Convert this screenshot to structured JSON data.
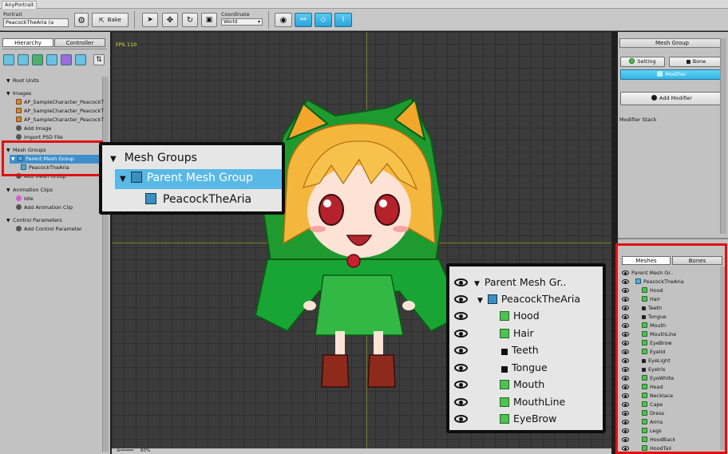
{
  "app": {
    "title": "AnyPortrait"
  },
  "toolbar": {
    "portrait_label": "Portrait",
    "portrait_value": "PeacockTheAria (a",
    "bake_label": "Bake",
    "coordinate_label": "Coordinate",
    "coordinate_value": "World"
  },
  "left_panel": {
    "tabs": [
      "Hierarchy",
      "Controller"
    ],
    "root_units": "Root Units",
    "images_header": "Images",
    "images": [
      "AP_SampleCharacter_PeacockT",
      "AP_SampleCharacter_PeacockT",
      "AP_SampleCharacter_PeacockT"
    ],
    "add_image": "Add Image",
    "import_psd": "Import PSD File",
    "mesh_groups_header": "Mesh Groups",
    "parent_mesh_group": "Parent Mesh Group",
    "child_mesh_group": "PeacockTheAria",
    "add_mesh_group": "Add Mesh Group",
    "animation_clips_header": "Animation Clips",
    "idle": "Idle",
    "add_animation_clip": "Add Animation Clip",
    "control_params_header": "Control Parameters",
    "add_control_param": "Add Control Parameter"
  },
  "viewport": {
    "fps": "FPS 110",
    "zoom": "60%"
  },
  "callout_left": {
    "header": "Mesh Groups",
    "parent": "Parent Mesh Group",
    "child": "PeacockTheAria"
  },
  "callout_right": {
    "root": "Parent Mesh Gr..",
    "child": "PeacockTheAria",
    "items": [
      "Hood",
      "Hair",
      "Teeth",
      "Tongue",
      "Mouth",
      "MouthLine",
      "EyeBrow"
    ]
  },
  "right_panel": {
    "header": "Mesh Group",
    "setting": "Setting",
    "bone": "Bone",
    "modifier": "Modifier",
    "add_modifier": "Add Modifier",
    "modifier_stack": "Modifier Stack",
    "tabs": [
      "Meshes",
      "Bones"
    ],
    "root": "Parent Mesh Gr..",
    "child": "PeacockTheAria",
    "meshes": [
      "Hood",
      "Hair",
      "Teeth",
      "Tongue",
      "Mouth",
      "MouthLine",
      "EyeBrow",
      "Eyelid",
      "EyeLight",
      "EyeIris",
      "EyeWhite",
      "Head",
      "Necklace",
      "Cape",
      "Dress",
      "Arms",
      "Legs",
      "HoodBack",
      "HoodTail"
    ]
  },
  "colors": {
    "accent": "#2aa3d8",
    "highlight": "#e01010",
    "viewport_bg": "#3b3b3b"
  }
}
